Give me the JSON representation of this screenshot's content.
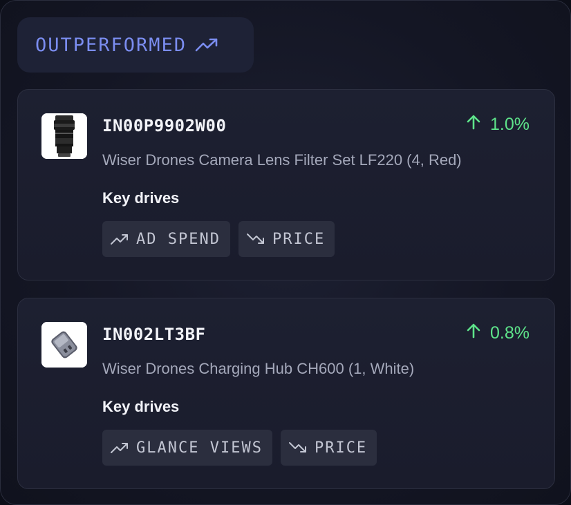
{
  "section": {
    "label": "OUTPERFORMED",
    "icon": "trending-up-icon",
    "accent_color": "#7b8df0"
  },
  "items": [
    {
      "sku": "IN00P9902W00",
      "title": "Wiser Drones Camera Lens Filter Set LF220 (4, Red)",
      "change": "1.0%",
      "change_direction": "up",
      "change_color": "#5ee48a",
      "image": "camera-lens-thumbnail",
      "drives_heading": "Key drives",
      "drives": [
        {
          "label": "AD SPEND",
          "icon": "trending-up-icon"
        },
        {
          "label": "PRICE",
          "icon": "trending-down-icon"
        }
      ]
    },
    {
      "sku": "IN002LT3BF",
      "title": "Wiser Drones Charging Hub CH600 (1, White)",
      "change": "0.8%",
      "change_direction": "up",
      "change_color": "#5ee48a",
      "image": "charging-hub-thumbnail",
      "drives_heading": "Key drives",
      "drives": [
        {
          "label": "GLANCE VIEWS",
          "icon": "trending-up-icon"
        },
        {
          "label": "PRICE",
          "icon": "trending-down-icon"
        }
      ]
    }
  ]
}
